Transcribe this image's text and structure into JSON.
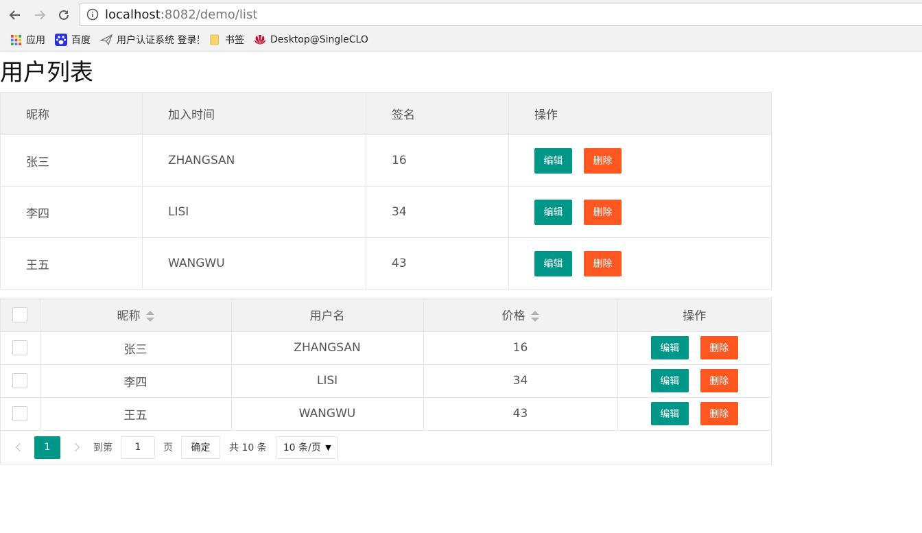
{
  "browser": {
    "url_host": "localhost",
    "url_rest": ":8082/demo/list",
    "bookmarks": [
      {
        "label": "应用",
        "icon": "apps-grid-icon"
      },
      {
        "label": "百度",
        "icon": "baidu-paw-icon"
      },
      {
        "label": "用户认证系统 登录界面",
        "icon": "paper-plane-icon"
      },
      {
        "label": "书签",
        "icon": "folder-icon"
      },
      {
        "label": "Desktop@SingleCLOUD",
        "icon": "huawei-logo-icon"
      }
    ]
  },
  "page": {
    "title": "用户列表"
  },
  "table1": {
    "headers": [
      "昵称",
      "加入时间",
      "签名",
      "操作"
    ],
    "rows": [
      {
        "nickname": "张三",
        "join": "ZHANGSAN",
        "sign": "16"
      },
      {
        "nickname": "李四",
        "join": "LISI",
        "sign": "34"
      },
      {
        "nickname": "王五",
        "join": "WANGWU",
        "sign": "43"
      }
    ],
    "edit_label": "编辑",
    "delete_label": "删除"
  },
  "table2": {
    "headers": [
      "昵称",
      "用户名",
      "价格",
      "操作"
    ],
    "rows": [
      {
        "nickname": "张三",
        "username": "ZHANGSAN",
        "price": "16"
      },
      {
        "nickname": "李四",
        "username": "LISI",
        "price": "34"
      },
      {
        "nickname": "王五",
        "username": "WANGWU",
        "price": "43"
      }
    ],
    "edit_label": "编辑",
    "delete_label": "删除",
    "pager": {
      "current_page": "1",
      "goto_label": "到第",
      "goto_value": "1",
      "page_label": "页",
      "confirm_label": "确定",
      "total_label": "共 10 条",
      "page_size": "10 条/页"
    }
  },
  "colors": {
    "edit": "#009688",
    "delete": "#ff5722"
  }
}
